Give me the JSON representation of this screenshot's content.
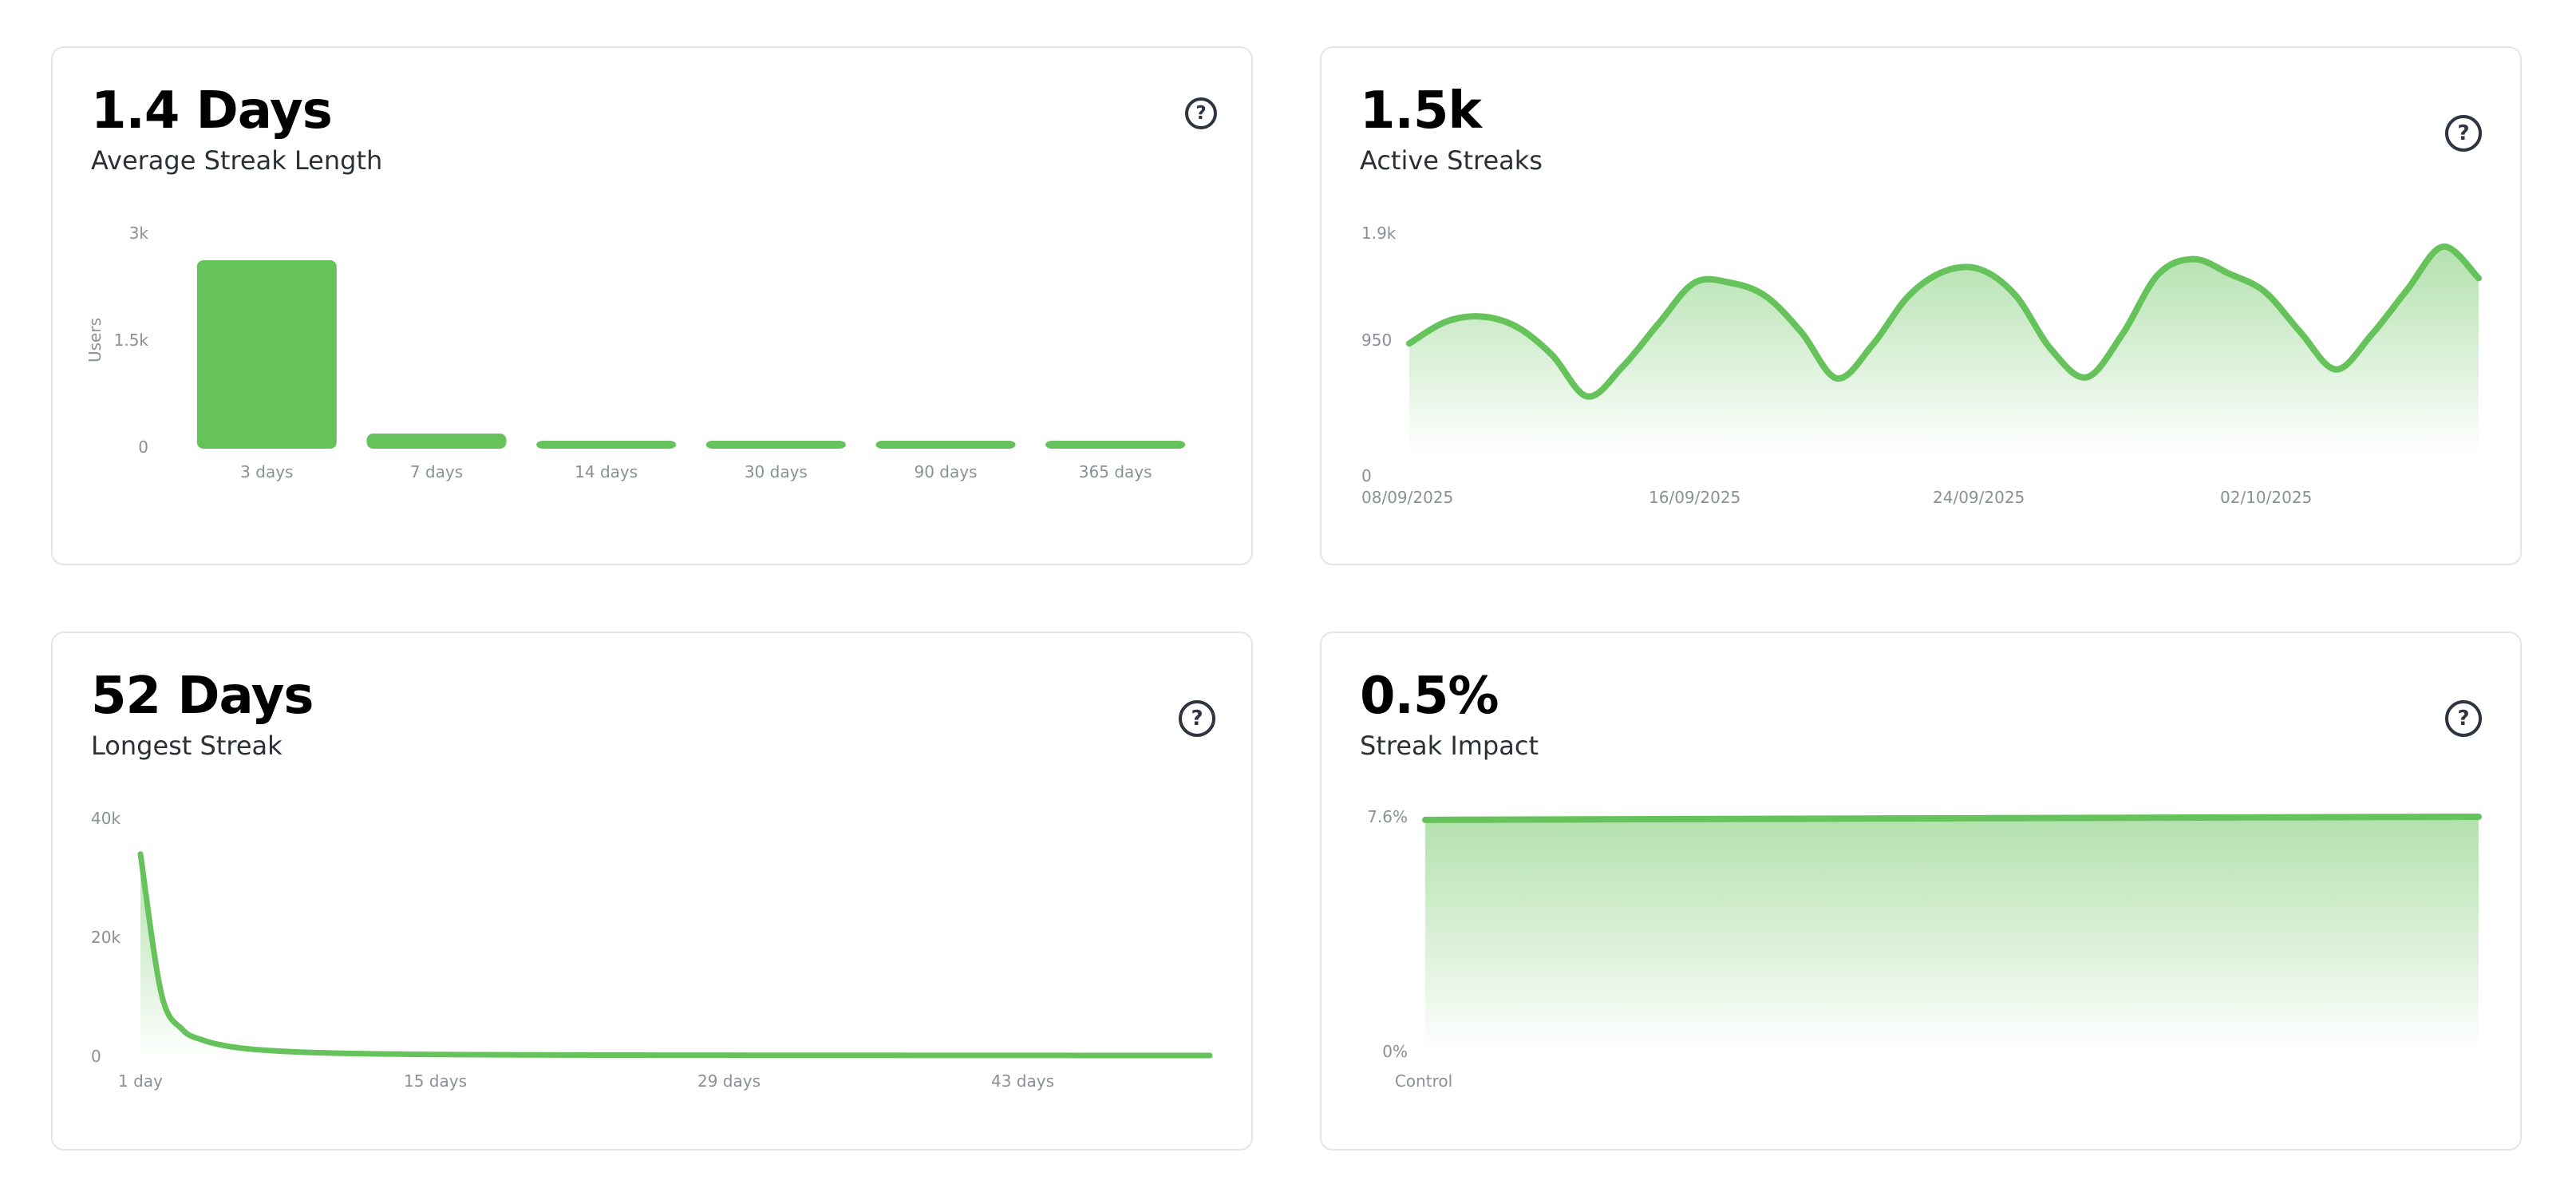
{
  "cards": [
    {
      "value": "1.4 Days",
      "label": "Average Streak Length",
      "help": "?",
      "chart_data": {
        "type": "bar",
        "title": "",
        "ylabel": "Users",
        "xlabel": "",
        "ylim": [
          0,
          3000
        ],
        "y_ticks": [
          "0",
          "1.5k",
          "3k"
        ],
        "categories": [
          "3 days",
          "7 days",
          "14 days",
          "30 days",
          "90 days",
          "365 days"
        ],
        "values": [
          2620,
          190,
          90,
          90,
          90,
          90
        ],
        "color": "#66c25a"
      }
    },
    {
      "value": "1.5k",
      "label": "Active Streaks",
      "help": "?",
      "chart_data": {
        "type": "area",
        "title": "",
        "ylim": [
          0,
          1900
        ],
        "y_ticks": [
          "0",
          "950",
          "1.9k"
        ],
        "x_ticks": [
          "08/09/2025",
          "16/09/2025",
          "24/09/2025",
          "02/10/2025"
        ],
        "x_start": "08/09/2025",
        "x": [
          "08/09/2025",
          "09/09/2025",
          "10/09/2025",
          "11/09/2025",
          "12/09/2025",
          "13/09/2025",
          "14/09/2025",
          "15/09/2025",
          "16/09/2025",
          "17/09/2025",
          "18/09/2025",
          "19/09/2025",
          "20/09/2025",
          "21/09/2025",
          "22/09/2025",
          "23/09/2025",
          "24/09/2025",
          "25/09/2025",
          "26/09/2025",
          "27/09/2025",
          "28/09/2025",
          "29/09/2025",
          "30/09/2025",
          "01/10/2025",
          "02/10/2025",
          "03/10/2025",
          "04/10/2025",
          "05/10/2025",
          "06/10/2025",
          "07/10/2025",
          "08/10/2025"
        ],
        "values": [
          920,
          1110,
          1160,
          1070,
          820,
          450,
          720,
          1100,
          1460,
          1460,
          1340,
          1020,
          610,
          910,
          1340,
          1560,
          1580,
          1350,
          870,
          620,
          1000,
          1530,
          1670,
          1540,
          1380,
          1020,
          690,
          1000,
          1400,
          1780,
          1500
        ],
        "color": "#66c25a"
      }
    },
    {
      "value": "52 Days",
      "label": "Longest Streak",
      "help": "?",
      "chart_data": {
        "type": "area",
        "title": "",
        "ylim": [
          0,
          40000
        ],
        "y_ticks": [
          "0",
          "20k",
          "40k"
        ],
        "x_ticks": [
          "1 day",
          "15 days",
          "29 days",
          "43 days"
        ],
        "x": [
          1,
          2,
          3,
          4,
          5,
          6,
          7,
          8,
          9,
          10,
          11,
          12,
          13,
          14,
          15,
          16,
          17,
          18,
          19,
          20,
          21,
          22,
          23,
          24,
          25,
          26,
          27,
          28,
          29,
          30,
          31,
          32,
          33,
          34,
          35,
          36,
          37,
          38,
          39,
          40,
          41,
          42,
          43,
          44,
          45,
          46,
          47,
          48,
          49,
          50,
          51,
          52
        ],
        "values": [
          34000,
          10500,
          4500,
          2700,
          1800,
          1300,
          1000,
          800,
          650,
          550,
          480,
          420,
          380,
          340,
          310,
          290,
          270,
          250,
          240,
          230,
          220,
          210,
          205,
          200,
          195,
          190,
          185,
          180,
          178,
          175,
          172,
          170,
          168,
          166,
          164,
          162,
          160,
          158,
          156,
          154,
          152,
          150,
          148,
          146,
          144,
          142,
          140,
          138,
          136,
          134,
          132,
          130
        ],
        "color": "#66c25a"
      }
    },
    {
      "value": "0.5%",
      "label": "Streak Impact",
      "help": "?",
      "chart_data": {
        "type": "area",
        "title": "",
        "ylim": [
          0,
          7.6
        ],
        "y_ticks": [
          "0%",
          "7.6%"
        ],
        "x_ticks": [
          "Control"
        ],
        "x": [
          "Control",
          ""
        ],
        "values": [
          7.5,
          7.6
        ],
        "color": "#66c25a"
      }
    }
  ]
}
